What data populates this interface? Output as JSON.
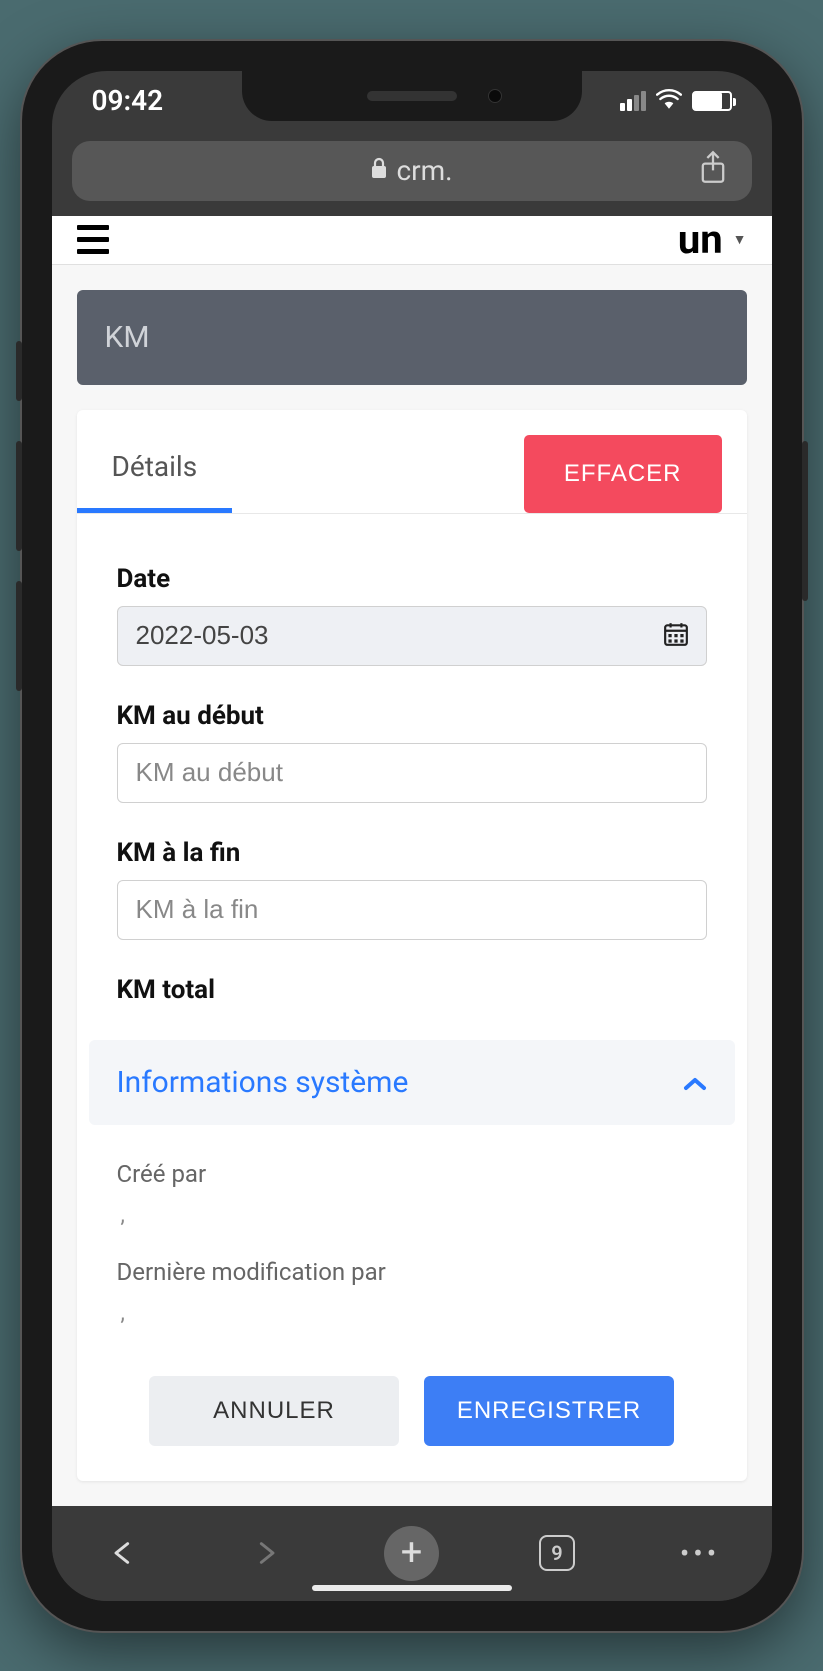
{
  "status": {
    "time": "09:42"
  },
  "browser": {
    "url_prefix": "crm.",
    "tab_count": "9"
  },
  "header": {
    "logo_text": "un"
  },
  "page": {
    "title": "KM"
  },
  "card": {
    "tab_label": "Détails",
    "erase_label": "EFFACER"
  },
  "form": {
    "date_label": "Date",
    "date_value": "2022-05-03",
    "km_start_label": "KM au début",
    "km_start_placeholder": "KM au début",
    "km_start_value": "",
    "km_end_label": "KM à la fin",
    "km_end_placeholder": "KM à la fin",
    "km_end_value": "",
    "km_total_label": "KM total"
  },
  "system": {
    "collapse_label": "Informations système",
    "created_by_label": "Créé par",
    "created_by_value": ",",
    "modified_by_label": "Dernière modification par",
    "modified_by_value": ","
  },
  "actions": {
    "cancel": "ANNULER",
    "save": "ENREGISTRER"
  }
}
